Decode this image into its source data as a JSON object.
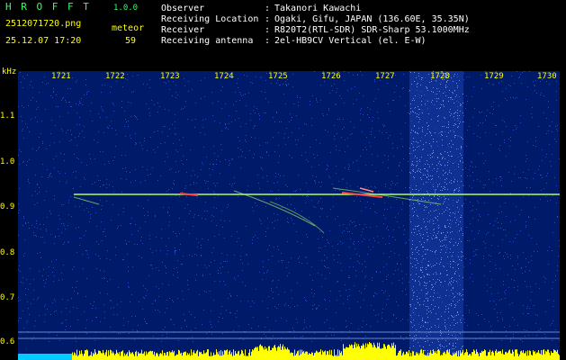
{
  "header": {
    "app_title": "H R O F F T",
    "app_version": "1.0.0",
    "file_name": "2512071720.png",
    "datetime": "25.12.07 17:20",
    "meteor_label": "meteor",
    "meteor_count": "59"
  },
  "info": [
    {
      "key": "Observer",
      "value": "Takanori Kawachi"
    },
    {
      "key": "Receiving Location",
      "value": "Ogaki, Gifu, JAPAN (136.60E, 35.35N)"
    },
    {
      "key": "Receiver",
      "value": "R820T2(RTL-SDR) SDR-Sharp 53.1000MHz"
    },
    {
      "key": "Receiving antenna",
      "value": "2el-HB9CV Vertical (el. E-W)"
    }
  ],
  "spectrogram": {
    "y_unit": "kHz",
    "y_ticks": [
      "1.1",
      "1.0",
      "0.9",
      "0.8",
      "0.7",
      "0.6"
    ],
    "time_ticks": [
      "1721",
      "1722",
      "1723",
      "1724",
      "1725",
      "1726",
      "1727",
      "1728",
      "1729",
      "1730"
    ],
    "colors": {
      "background": "#001a6a",
      "noise": "#2a5bd6",
      "carrier": "#aaff66",
      "trail": "#ff4444",
      "level": "#ffff00",
      "level_low": "#00ccff"
    }
  }
}
